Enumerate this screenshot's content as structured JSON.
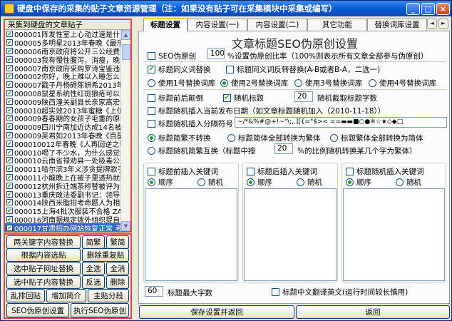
{
  "window": {
    "title": "硬盘中保存的采集的贴子文章资源管理（注：如果没有贴子可在采集模块中采集或编写）",
    "controls": {
      "minimize": "_",
      "maximize": "□",
      "close": "×"
    }
  },
  "left_panel": {
    "header": "采集到硬盘的文章贴子",
    "items": [
      {
        "label": "000001阵发性室上心动过速是什么",
        "checked": true
      },
      {
        "label": "000005多明星2013年春晚《最乐蛇",
        "checked": true
      },
      {
        "label": "000006南京政府将公开三公经费及",
        "checked": true
      },
      {
        "label": "000003我有慢性腹泻，消瘦，晚上",
        "checked": true
      },
      {
        "label": "000007南京政府采购罗诗宝鉴违规",
        "checked": true
      },
      {
        "label": "000002你好，晚上难以入睡怎么办",
        "checked": true
      },
      {
        "label": "000007戳子丹杨碍陈妍希2013年春",
        "checked": true
      },
      {
        "label": "000008鼠星系统性红斑狼疮可以医",
        "checked": true
      },
      {
        "label": "000009陕西潼关副县长亲家高宏被",
        "checked": true
      },
      {
        "label": "000010超实效2013年蜜糖《上位》",
        "checked": true
      },
      {
        "label": "000009春春期的女孩子毛重的原因",
        "checked": true
      },
      {
        "label": "000009四川宁南加近达成14名被",
        "checked": true
      },
      {
        "label": "000009吴君如2013年春晚《百星演",
        "checked": true
      },
      {
        "label": "000010012年春晚《人再回逆之春",
        "checked": true
      },
      {
        "label": "000010喝了不少水，为什么感觉嘴",
        "checked": true
      },
      {
        "label": "000010云南省禄劝县一处吸毒公路",
        "checked": true
      },
      {
        "label": "000011哈尔滨3年义涉贪提牌歌手",
        "checked": true
      },
      {
        "label": "000011小龍晚上在被子里透热就醒",
        "checked": true
      },
      {
        "label": "000012杭州拆迁端茶称替被评为优",
        "checked": true
      },
      {
        "label": "000013重庆政法委副书记：领导干",
        "checked": true
      },
      {
        "label": "000014陕西米脂招考命题人为相貌",
        "checked": true
      },
      {
        "label": "000015上海4批次服装不合格 ZAR",
        "checked": true
      },
      {
        "label": "000016河南据规定拨外组织提自调",
        "checked": true
      },
      {
        "label": "000017甘肃招办网站恢复正常 考",
        "checked": true,
        "selected": true
      }
    ]
  },
  "left_buttons": {
    "b1": "两关键字内容替换",
    "b2": "简繁",
    "b3": "繁简",
    "b4": "根据内容选贴",
    "b5": "删除重复贴",
    "b6": "选中贴子网址替换",
    "b7": "全选",
    "b8": "全消",
    "b9": "选中贴子内容替换",
    "b10": "反选",
    "b11": "删除",
    "b12": "乱排回贴",
    "b13": "增加简介",
    "b14": "主贴分段",
    "b15": "SEO伪原创设置",
    "b16": "执行SEO伪原创"
  },
  "tabs": [
    "标题设置",
    "内容设置(一)",
    "内容设置(二)",
    "其它功能",
    "替换词库设置"
  ],
  "settings": {
    "heading": "文章标题SEO伪原创设置",
    "seo_pseudo": "SEO伪原创",
    "ratio_value": "100",
    "ratio_label": "%设置伪原创比率（100%则表示所有文章全部参与伪原创）",
    "synonym_replace": "标题同义词替换",
    "synonym_reverse": "标题同义词反转替换(A-B或者B-A，二选一)",
    "lib1": "使用1号替换词库",
    "lib2": "使用2号替换词库",
    "lib3": "使用3号替换词库",
    "lib4": "使用4号替换词库",
    "pre_post": "标题前后颠倒",
    "random_title": "随机标题",
    "random_len_value": "20",
    "random_len_label": "随机截取标题字数",
    "insert_date": "标题随机插入当前发布日期（如文章标题随机加入（2010-11-18））",
    "insert_sep": "标题随机插入分隔符号",
    "sep_chars": "~/*&%#@+!~\"\\;,.][{=\"$>< ==▬▬■○●※☆★◇◆□",
    "no_convert": "标题简繁不转换",
    "to_trad": "标题简体全部转换为繁体",
    "to_simp": "标题繁体全部转换为简体",
    "random_mix": "标题随机简繁互换（标题中按",
    "mix_value": "20",
    "mix_label": "%的比例随机转换某几个字为繁体）",
    "prefix_kw": "标题前插入关键词",
    "suffix_kw": "标题后插入关键词",
    "random_kw": "标题随机插入关键词",
    "order": "顺序",
    "random": "随机",
    "max_len_value": "60",
    "max_len_label": "标题最大字数",
    "translate": "标题中文翻译英文(运行时间较长慎用)"
  },
  "bottom": {
    "save": "保存设置并返回",
    "back": "返回"
  }
}
